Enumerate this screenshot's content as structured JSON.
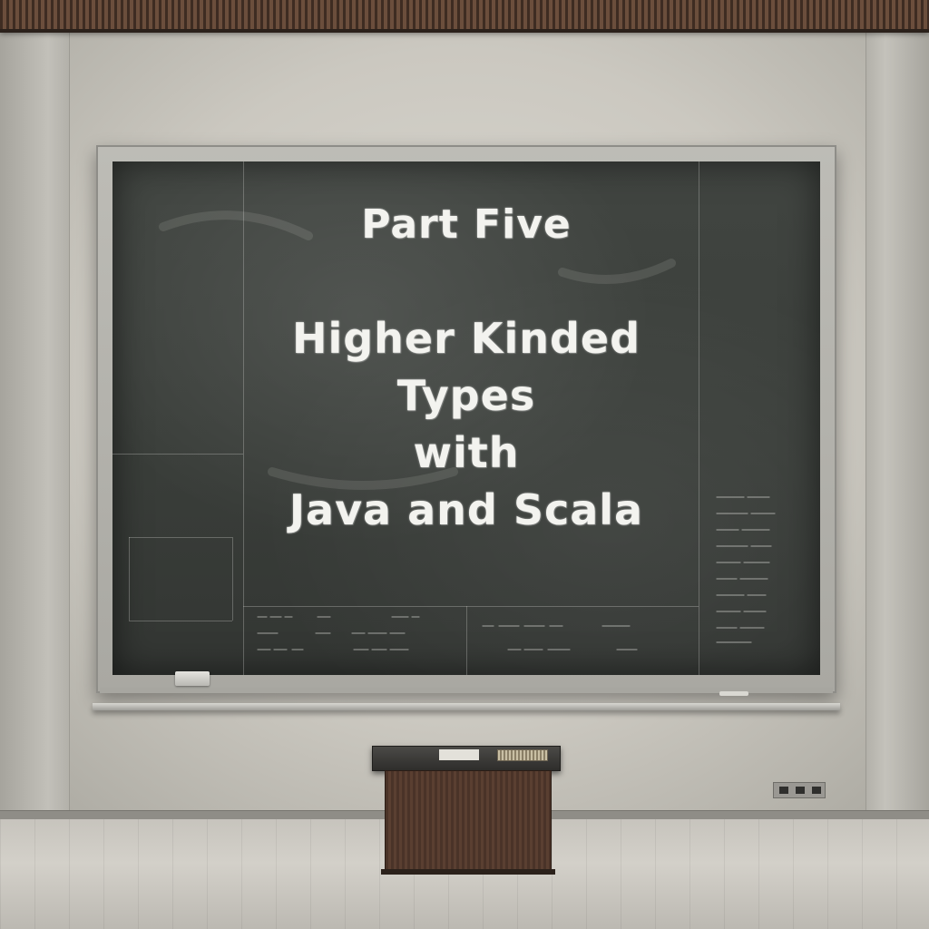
{
  "blackboard": {
    "part_label": "Part Five",
    "title_lines": [
      "Higher Kinded",
      "Types",
      "with",
      "Java and Scala"
    ]
  }
}
